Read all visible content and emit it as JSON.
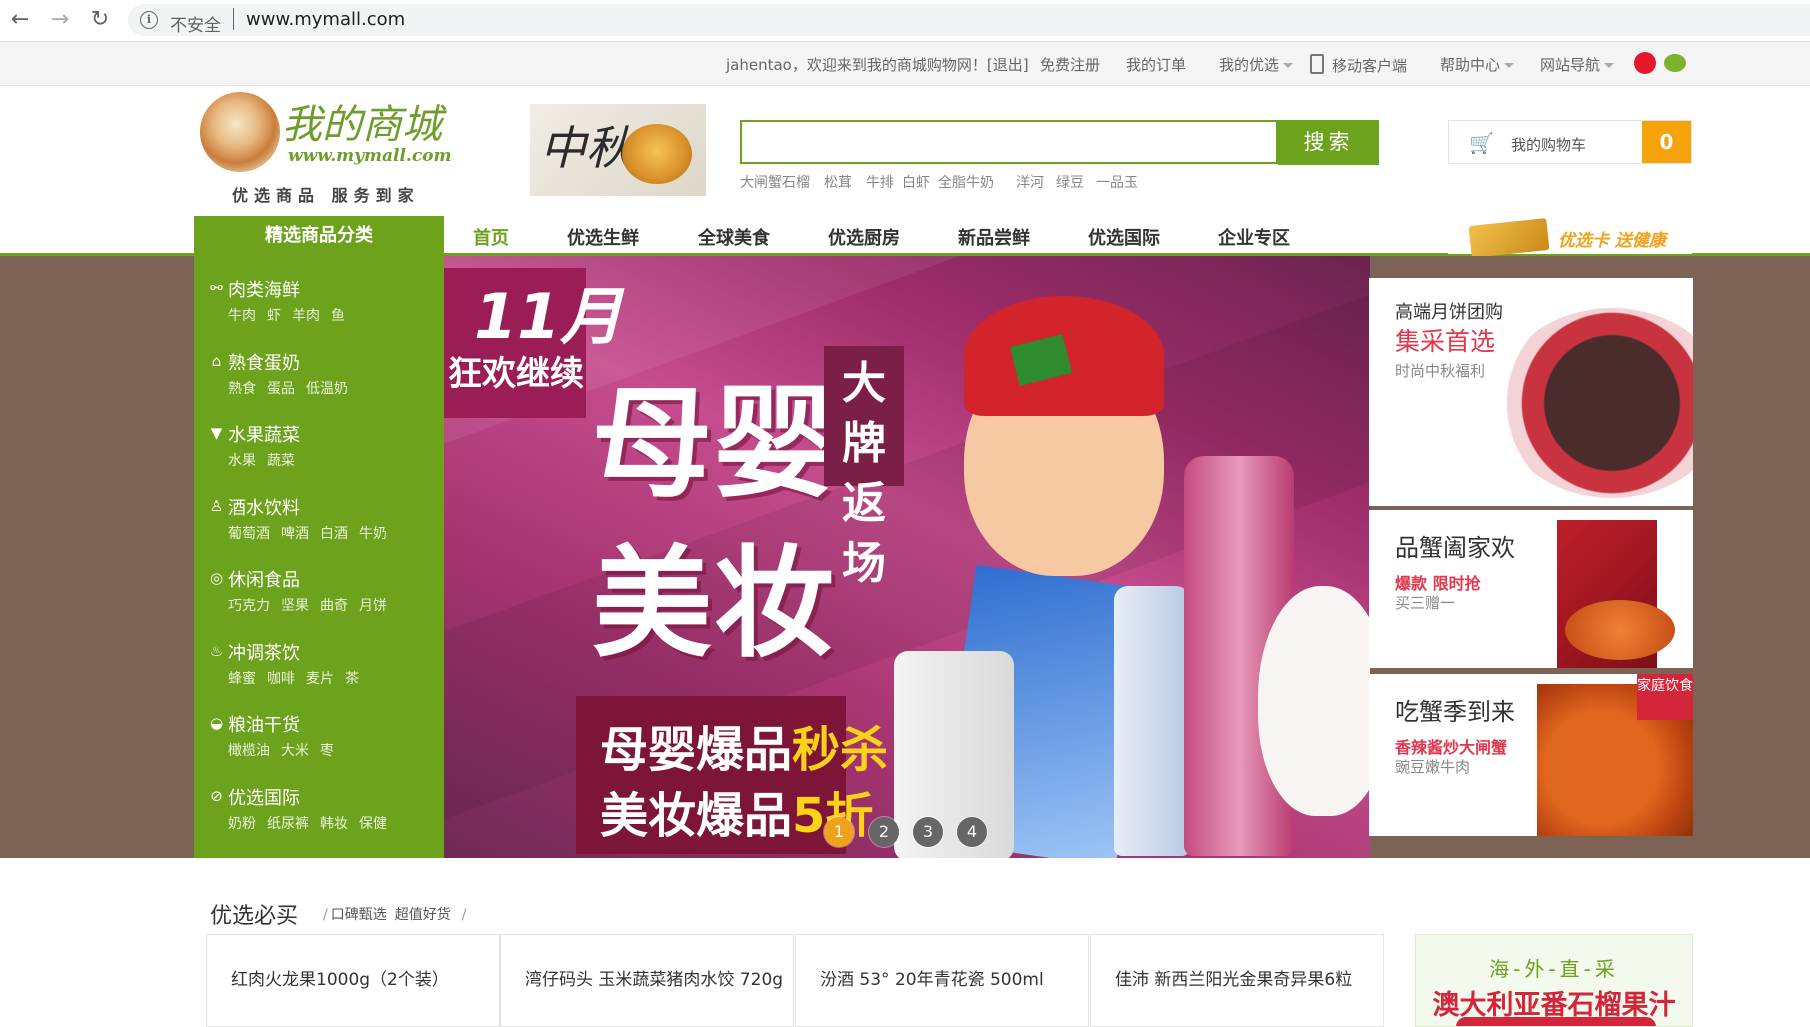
{
  "browser": {
    "back": "←",
    "forward": "→",
    "reload": "↻",
    "insecure_label": "不安全",
    "url": "www.mymall.com"
  },
  "topbar": {
    "welcome": "jahentao，欢迎来到我的商城购物网！[退出]",
    "register": "免费注册",
    "orders": "我的订单",
    "my_youxuan": "我的优选",
    "mobile": "移动客户端",
    "help": "帮助中心",
    "site_nav": "网站导航",
    "colors": {
      "weibo": "#e6162d",
      "wechat": "#7bb32e"
    }
  },
  "logo": {
    "title": "我的商城",
    "url": "www.mymall.com",
    "slogan": "优选商品  服务到家"
  },
  "header_promo": {
    "text": "中秋"
  },
  "search": {
    "value": "",
    "button": "搜索",
    "hot_words": [
      "大闸蟹",
      "石榴",
      "松茸",
      "牛排",
      "白虾",
      "全脂牛奶",
      "洋河",
      "绿豆",
      "一品玉"
    ]
  },
  "cart": {
    "label": "我的购物车",
    "count": "0"
  },
  "nav": {
    "category_title": "精选商品分类",
    "items": [
      "首页",
      "优选生鲜",
      "全球美食",
      "优选厨房",
      "新品尝鲜",
      "优选国际",
      "企业专区"
    ],
    "active_index": 0,
    "promo_card": "优选卡 送健康"
  },
  "categories": [
    {
      "name": "肉类海鲜",
      "icon": "fish-icon",
      "glyph": "⚯",
      "subs": [
        "牛肉",
        "虾",
        "羊肉",
        "鱼"
      ]
    },
    {
      "name": "熟食蛋奶",
      "icon": "milk-carton-icon",
      "glyph": "⌂",
      "subs": [
        "熟食",
        "蛋品",
        "低温奶"
      ]
    },
    {
      "name": "水果蔬菜",
      "icon": "fruit-basket-icon",
      "glyph": "▼",
      "subs": [
        "水果",
        "蔬菜"
      ]
    },
    {
      "name": "酒水饮料",
      "icon": "wine-glass-icon",
      "glyph": "♙",
      "subs": [
        "葡萄酒",
        "啤酒",
        "白酒",
        "牛奶"
      ]
    },
    {
      "name": "休闲食品",
      "icon": "lollipop-icon",
      "glyph": "◎",
      "subs": [
        "巧克力",
        "坚果",
        "曲奇",
        "月饼"
      ]
    },
    {
      "name": "冲调茶饮",
      "icon": "teacup-icon",
      "glyph": "♨",
      "subs": [
        "蜂蜜",
        "咖啡",
        "麦片",
        "茶"
      ]
    },
    {
      "name": "粮油干货",
      "icon": "rice-bowl-icon",
      "glyph": "◒",
      "subs": [
        "橄榄油",
        "大米",
        "枣"
      ]
    },
    {
      "name": "优选国际",
      "icon": "globe-icon",
      "glyph": "⊘",
      "subs": [
        "奶粉",
        "纸尿裤",
        "韩妆",
        "保健"
      ]
    }
  ],
  "hero": {
    "month": "11月",
    "subtitle": "狂欢继续",
    "headline1": "母婴",
    "headline2": "美妆",
    "tag": "大牌返场",
    "promo1_prefix": "母婴爆品",
    "promo1_highlight": "秒杀",
    "promo2_prefix": "美妆爆品",
    "promo2_highlight": "5折",
    "dots": [
      "1",
      "2",
      "3",
      "4"
    ],
    "active_dot": 0
  },
  "side_promos": [
    {
      "line1": "高端月饼团购",
      "line2": "集采首选",
      "line3": "时尚中秋福利"
    },
    {
      "line1": "品蟹阖家欢",
      "line2": "爆款 限时抢",
      "line3": "买三赠一"
    },
    {
      "line1": "吃蟹季到来",
      "line2": "香辣酱炒大闸蟹",
      "line3": "豌豆嫩牛肉",
      "badge": "家庭饮食"
    }
  ],
  "section": {
    "title": "优选必买",
    "tags": [
      "口碑甄选",
      "超值好货"
    ],
    "products": [
      "红肉火龙果1000g（2个装）",
      "湾仔码头 玉米蔬菜猪肉水饺 720g",
      "汾酒 53° 20年青花瓷 500ml",
      "佳沛 新西兰阳光金果奇异果6粒"
    ],
    "overseas_line1": "海-外-直-采",
    "overseas_line2": "澳大利亚番石榴果汁"
  },
  "colors": {
    "accent": "#6ca21c",
    "cart_badge": "#f5a20b",
    "promo_red": "#e2384d",
    "dot_active": "#f0a21b"
  }
}
